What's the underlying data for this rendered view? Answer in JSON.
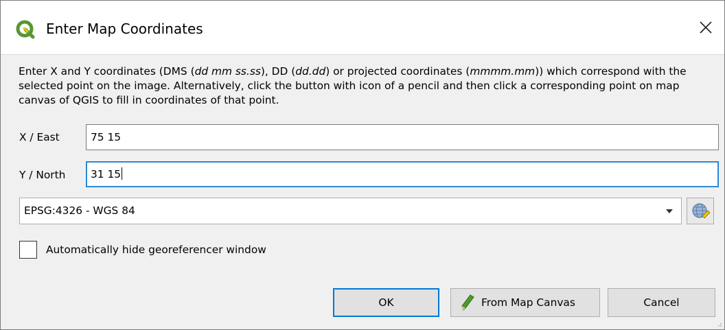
{
  "window": {
    "title": "Enter Map Coordinates",
    "close_symbol": "✕"
  },
  "description": {
    "part1": "Enter X and Y coordinates (DMS (",
    "dms_format": "dd mm ss.ss",
    "part2": "), DD (",
    "dd_format": "dd.dd",
    "part3": ") or projected coordinates (",
    "projected_format": "mmmm.mm",
    "part4": ")) which correspond with the selected point on the image. Alternatively, click the button with icon of a pencil and then click a corresponding point on map canvas of QGIS to fill in coordinates of that point."
  },
  "fields": {
    "x_label": "X / East",
    "x_value": "75 15",
    "y_label": "Y / North",
    "y_value": "31 15"
  },
  "crs": {
    "selected": "EPSG:4326 - WGS 84"
  },
  "options": {
    "auto_hide_label": "Automatically hide georeferencer window",
    "auto_hide_checked": false
  },
  "buttons": {
    "ok_label": "OK",
    "from_map_canvas_label": "From Map Canvas",
    "cancel_label": "Cancel"
  },
  "icons": {
    "app": "qgis-logo-icon",
    "close": "close-icon",
    "dropdown": "chevron-down-icon",
    "crs_selector": "globe-crs-icon",
    "pencil": "pencil-icon"
  },
  "colors": {
    "focus_border": "#1a7fd4",
    "default_button_border": "#0078d7",
    "qgis_green": "#589632",
    "qgis_yellow": "#eec90d"
  }
}
